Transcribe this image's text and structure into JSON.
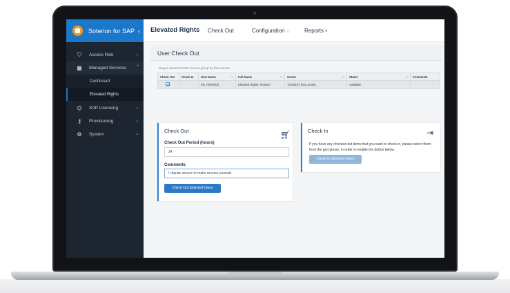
{
  "app": {
    "name": "Soterion for SAP",
    "page_title": "Elevated Rights",
    "brand_chevron": "‹"
  },
  "nav": [
    {
      "label": "Check Out",
      "has_menu": false
    },
    {
      "label": "Configuration",
      "has_menu": true
    },
    {
      "label": "Reports",
      "has_menu": true
    }
  ],
  "sidebar": {
    "items": [
      {
        "label": "Access Risk",
        "icon": "shield-icon",
        "glyph": "⛉"
      },
      {
        "label": "Managed Services",
        "icon": "grid-icon",
        "glyph": "▦"
      },
      {
        "label": "SAP Licensing",
        "icon": "tag-icon",
        "glyph": "⌬"
      },
      {
        "label": "Provisioning",
        "icon": "key-icon",
        "glyph": "⚷"
      },
      {
        "label": "System",
        "icon": "gears-icon",
        "glyph": "⚙"
      }
    ],
    "sub_items": [
      {
        "label": "Dashboard"
      },
      {
        "label": "Elevated Rights"
      }
    ]
  },
  "section": {
    "title": "User Check Out",
    "grid_hint": "Drag a column header here to group by that column"
  },
  "grid": {
    "columns": [
      "Check Out",
      "Check In",
      "User Name",
      "Full Name",
      "Owner",
      "Status",
      "Comments"
    ],
    "rows": [
      {
        "check_out": true,
        "check_in": "",
        "user_name": "ER_FINANCE",
        "full_name": "Elevated Rights: Finance",
        "owner": "TJONES (Tony Jones)",
        "status": "Available",
        "comments": ""
      }
    ]
  },
  "checkout": {
    "title": "Check Out",
    "icon": "cart-icon",
    "period_label": "Check Out Period (hours)",
    "period_value": "24",
    "comments_label": "Comments",
    "comments_value": "I require access to make reverse journals",
    "button": "Check Out Selected Users"
  },
  "checkin": {
    "title": "Check In",
    "icon": "sign-in-icon",
    "text": "If you have any checked out items that you want to check in, please select them from the grid above, in order to enable the button below.",
    "button": "Check In Selected Users"
  },
  "colors": {
    "accent": "#1b77c9",
    "sidebar_bg": "#1d2530",
    "logo": "#f39a1e"
  }
}
